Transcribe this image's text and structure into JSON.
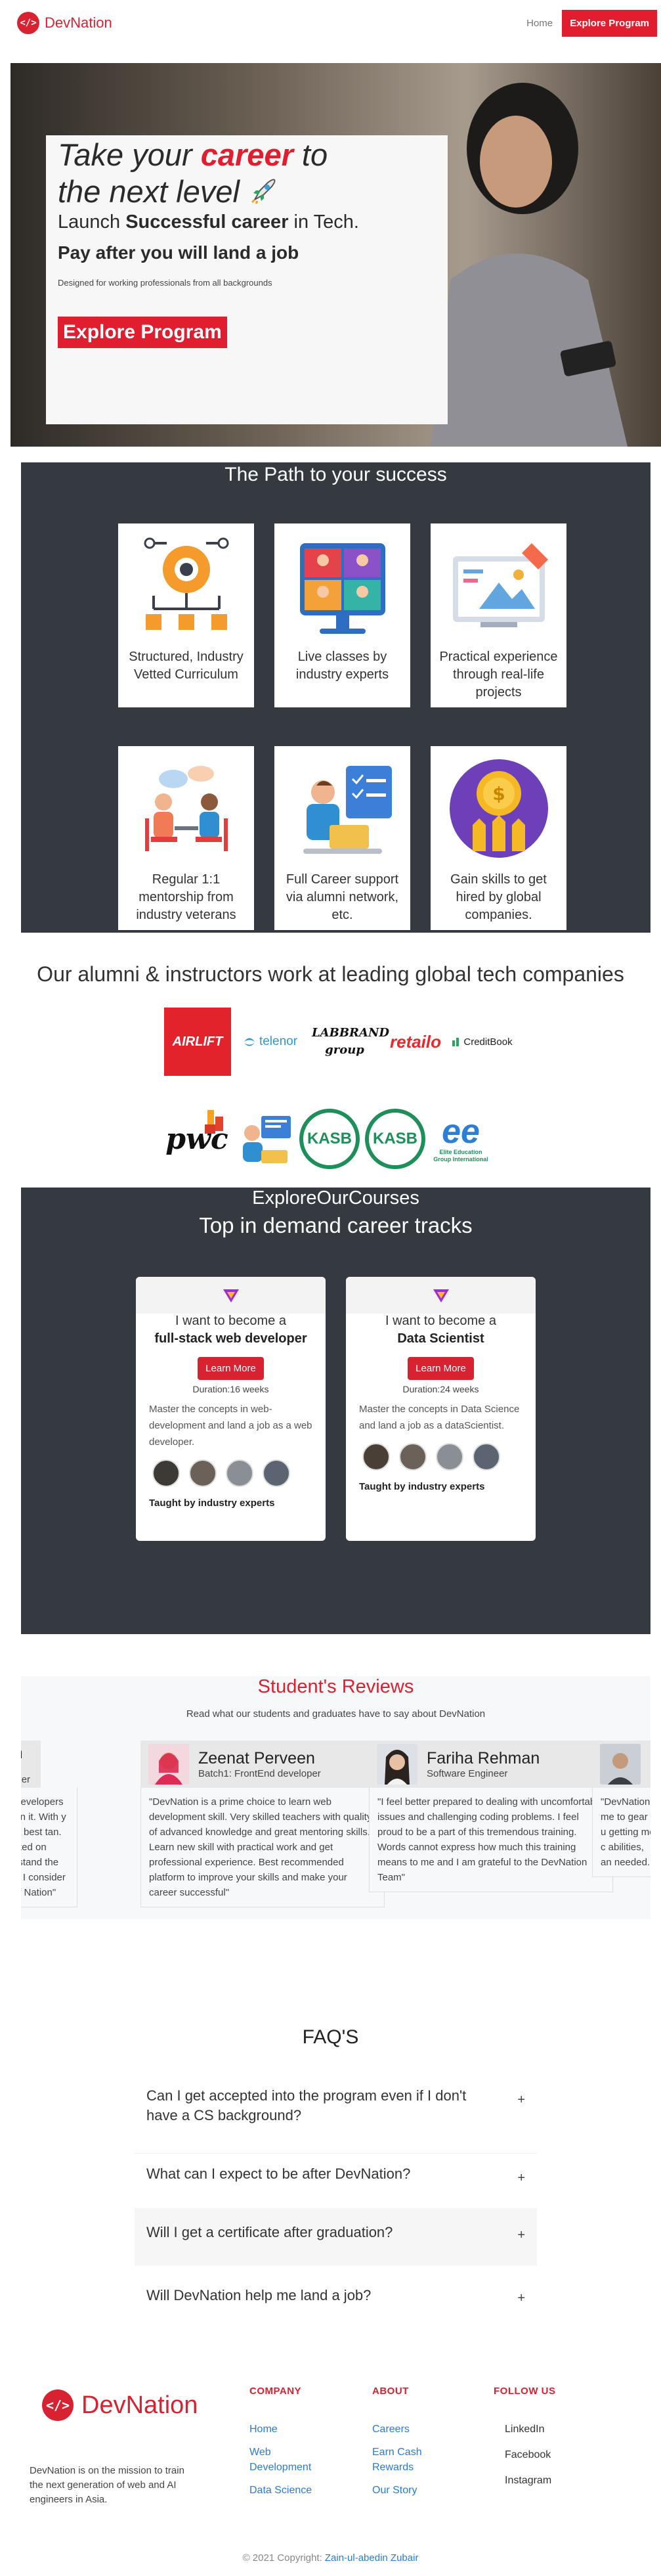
{
  "nav": {
    "brand": "DevNation",
    "logo_glyph": "</>",
    "home": "Home",
    "cta": "Explore Program"
  },
  "hero": {
    "line1_pre": "Take your ",
    "line1_accent": "career",
    "line1_post": " to",
    "line2": "the next level",
    "launch_pre": "Launch ",
    "launch_bold": "Successful career",
    "launch_post": " in Tech.",
    "pay": "Pay after you will land a job",
    "sub": "Designed for working professionals from all backgrounds",
    "cta": "Explore Program"
  },
  "path": {
    "title": "The Path to your success",
    "cards": [
      {
        "label": "Structured, Industry Vetted Curriculum",
        "icon": "gear-flowchart-icon"
      },
      {
        "label": "Live classes by industry experts",
        "icon": "video-call-icon"
      },
      {
        "label": "Practical experience through real-life projects",
        "icon": "design-board-icon"
      },
      {
        "label": "Regular 1:1 mentorship from industry veterans",
        "icon": "mentorship-icon"
      },
      {
        "label": "Full Career support via alumni network, etc.",
        "icon": "career-support-icon"
      },
      {
        "label": "Gain skills to get hired by global companies.",
        "icon": "coin-growth-icon"
      }
    ]
  },
  "companies": {
    "title": "Our alumni & instructors work at leading global tech companies",
    "row1": [
      "AIRLIFT",
      "telenor",
      "LABBRAND group",
      "retailo",
      "CreditBook"
    ],
    "row2": [
      "pwc",
      "KASB",
      "KASB",
      "ee",
      "Elite Education Group International"
    ]
  },
  "courses": {
    "kicker": "ExploreOurCourses",
    "title": "Top in demand career tracks",
    "items": [
      {
        "want": "I want to become a",
        "track": "full-stack web developer",
        "button": "Learn More",
        "duration": "Duration:16 weeks",
        "desc": "Master the concepts in web-development and land a job as a web developer.",
        "taught": "Taught by industry experts"
      },
      {
        "want": "I want to become a",
        "track": "Data Scientist",
        "button": "Learn More",
        "duration": "Duration:24 weeks",
        "desc": "Master the concepts in Data Science and land a job as a dataScientist.",
        "taught": "Taught by industry experts"
      }
    ]
  },
  "reviews": {
    "title": "Student's Reviews",
    "sub": "Read what our students and graduates have to say about DevNation",
    "items": [
      {
        "name": "man",
        "role": "re Engineer",
        "text": "n for developers to ert in it. With y it's the best tan. It worked on understand the better. I consider myself Nation\""
      },
      {
        "name": "Zeenat Perveen",
        "role": "Batch1: FrontEnd developer",
        "text": "\"DevNation is a prime choice to learn web development skill. Very skilled teachers with quality of advanced knowledge and great mentoring skills. Learn new skill with practical work and get professional experience. Best recommended platform to improve your skills and make your career successful\""
      },
      {
        "name": "Fariha Rehman",
        "role": "Software Engineer",
        "text": "\"I feel better prepared to dealing with uncomfortable issues and challenging coding problems. I feel proud to be a part of this tremendous training. Words cannot express how much this training means to me and I am grateful to the DevNation Team\""
      },
      {
        "name": "",
        "role": "",
        "text": "\"DevNation me to gear u getting me c abilities, an needed."
      }
    ]
  },
  "faq": {
    "title": "FAQ'S",
    "items": [
      "Can I get accepted into the program even if I don't have a CS background?",
      "What can I expect to be after DevNation?",
      "Will I get a certificate after graduation?",
      "Will DevNation help me land a job?"
    ],
    "toggle": "+"
  },
  "footer": {
    "brand": "DevNation",
    "desc": "DevNation is on the mission to train the next generation of web and AI engineers in Asia.",
    "company": {
      "title": "COMPANY",
      "links": [
        "Home",
        "Web Development",
        "Data Science"
      ]
    },
    "about": {
      "title": "ABOUT",
      "links": [
        "Careers",
        "Earn Cash Rewards",
        "Our Story"
      ]
    },
    "follow": {
      "title": "FOLLOW US",
      "links": [
        "LinkedIn",
        "Facebook",
        "Instagram"
      ]
    },
    "copyright": "© 2021 Copyright: ",
    "author": "Zain-ul-abedin Zubair"
  },
  "colors": {
    "accent": "#e01e2f",
    "dark_panel": "#343a40",
    "link": "#2a7ad9"
  }
}
